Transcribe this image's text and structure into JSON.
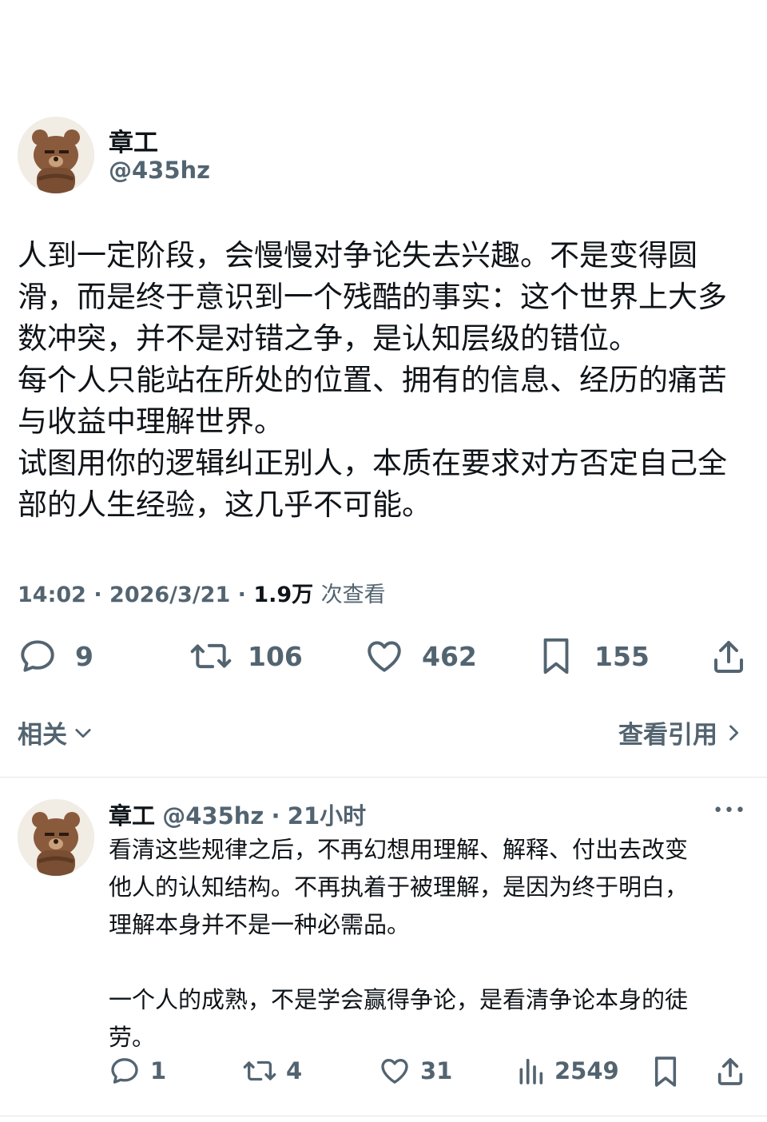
{
  "tweet": {
    "author_name": "章工",
    "handle": "@435hz",
    "lines": [
      "人到一定阶段，会慢慢对争论失去兴趣。不是变得圆",
      "滑，而是终于意识到一个残酷的事实：这个世界上大多",
      "数冲突，并不是对错之争，是认知层级的错位。",
      "每个人只能站在所处的位置、拥有的信息、经历的痛苦",
      "与收益中理解世界。",
      "试图用你的逻辑纠正别人，本质在要求对方否定自己全",
      "部的人生经验，这几乎不可能。"
    ],
    "time": "14:02",
    "date": "2026/3/21",
    "views": "1.9万",
    "views_label": "次查看",
    "separator": "·",
    "replies": "9",
    "retweets": "106",
    "likes": "462",
    "bookmarks": "155"
  },
  "related": {
    "label": "相关",
    "quotes_label": "查看引用"
  },
  "reply": {
    "author_name": "章工",
    "handle": "@435hz",
    "separator": "·",
    "time_ago": "21小时",
    "more": "•••",
    "lines": [
      "看清这些规律之后，不再幻想用理解、解释、付出去改变",
      "他人的认知结构。不再执着于被理解，是因为终于明白，",
      "理解本身并不是一种必需品。",
      "",
      "一个人的成熟，不是学会赢得争论，是看清争论本身的徒",
      "劳。"
    ],
    "replies": "1",
    "retweets": "4",
    "likes": "31",
    "views": "2549"
  },
  "colors": {
    "text": "#0f1419",
    "secondary": "#536471",
    "divider": "#e1e6ea",
    "avatar_bg": "#f1ece4",
    "bear": "#8a5a3c"
  },
  "icons": [
    "reply-icon",
    "retweet-icon",
    "like-icon",
    "bookmark-icon",
    "share-icon",
    "views-icon",
    "chevron-down-icon",
    "chevron-right-icon",
    "more-icon"
  ]
}
